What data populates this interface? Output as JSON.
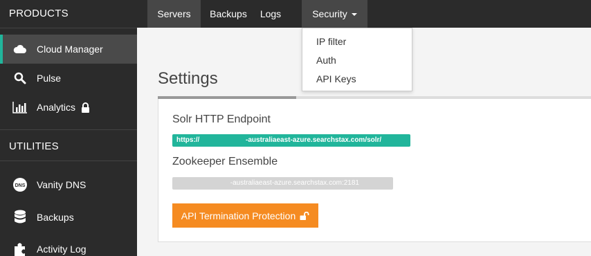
{
  "sidebar": {
    "products_header": "PRODUCTS",
    "utilities_header": "UTILITIES",
    "products": [
      {
        "label": "Cloud Manager",
        "icon": "cloud-icon",
        "active": true
      },
      {
        "label": "Pulse",
        "icon": "search-icon"
      },
      {
        "label": "Analytics",
        "icon": "bar-chart-icon",
        "locked": true
      }
    ],
    "utilities": [
      {
        "label": "Vanity DNS",
        "icon": "dns-icon",
        "icon_text": "DNS"
      },
      {
        "label": "Backups",
        "icon": "database-icon"
      },
      {
        "label": "Activity Log",
        "icon": "puzzle-icon"
      }
    ]
  },
  "topnav": {
    "tabs": [
      {
        "label": "Servers"
      },
      {
        "label": "Backups"
      },
      {
        "label": "Logs"
      },
      {
        "label": "Security"
      }
    ]
  },
  "security_menu": {
    "items": [
      {
        "label": "IP filter"
      },
      {
        "label": "Auth"
      },
      {
        "label": "API Keys"
      }
    ]
  },
  "main": {
    "title": "Settings",
    "solr_label": "Solr HTTP Endpoint",
    "solr_value": "https://                        -australiaeast-azure.searchstax.com/solr/",
    "zk_label": "Zookeeper Ensemble",
    "zk_value": "                            -australiaeast-azure.searchstax.com:2181",
    "termination_button": "API Termination Protection"
  },
  "colors": {
    "accent_teal": "#21b59b",
    "accent_orange": "#f58b21",
    "sidebar_bg": "#2b2b2b"
  }
}
